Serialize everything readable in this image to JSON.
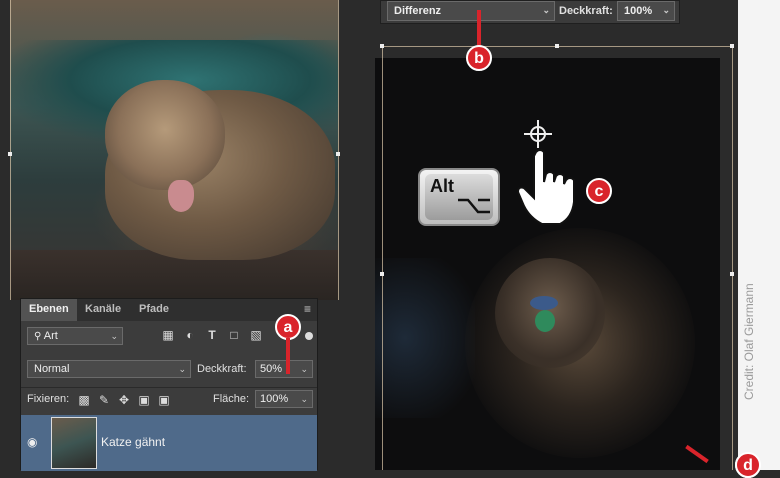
{
  "blend_bar": {
    "mode_value": "Differenz",
    "opacity_label": "Deckkraft:",
    "opacity_value": "100%"
  },
  "layers_panel": {
    "tabs": [
      "Ebenen",
      "Kanäle",
      "Pfade"
    ],
    "filter_value": "Art",
    "blend_mode_value": "Normal",
    "opacity_label": "Deckkraft:",
    "opacity_value": "50%",
    "lock_label": "Fixieren:",
    "fill_label": "Fläche:",
    "fill_value": "100%",
    "layer": {
      "name": "Katze gähnt"
    }
  },
  "keyboard": {
    "key_label": "Alt"
  },
  "callouts": {
    "a": "a",
    "b": "b",
    "c": "c",
    "d": "d"
  },
  "credit": "Credit: Olaf Giermann",
  "colors": {
    "callout": "#d9242b",
    "panel": "#3c3c3c",
    "layer_selected": "#4f6a8a"
  },
  "icons": [
    "search-icon",
    "chevron-down-icon",
    "image-filter-icon",
    "adjustment-filter-icon",
    "type-filter-icon",
    "shape-filter-icon",
    "smartobject-filter-icon",
    "panel-menu-icon",
    "eye-icon",
    "lock-transparent-icon",
    "lock-brush-icon",
    "lock-move-icon",
    "lock-artboard-icon",
    "lock-all-icon",
    "crosshair-icon",
    "hand-cursor-icon"
  ]
}
